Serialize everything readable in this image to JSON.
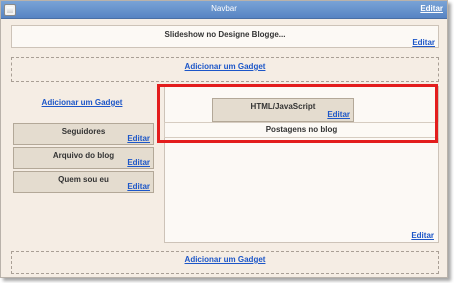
{
  "navbar": {
    "title": "Navbar",
    "edit": "Editar"
  },
  "header": {
    "title": "Slideshow no Designe Blogge...",
    "edit": "Editar"
  },
  "add_gadget": "Adicionar um Gadget",
  "sidebar": {
    "widgets": [
      {
        "title": "Seguidores",
        "edit": "Editar"
      },
      {
        "title": "Arquivo do blog",
        "edit": "Editar"
      },
      {
        "title": "Quem sou eu",
        "edit": "Editar"
      }
    ]
  },
  "main": {
    "html_widget": {
      "title": "HTML/JavaScript",
      "edit": "Editar"
    },
    "posts_title": "Postagens no blog",
    "edit": "Editar"
  },
  "colors": {
    "highlight": "#e31d1d",
    "link": "#1c56c8",
    "navbar": "#5784c3"
  }
}
